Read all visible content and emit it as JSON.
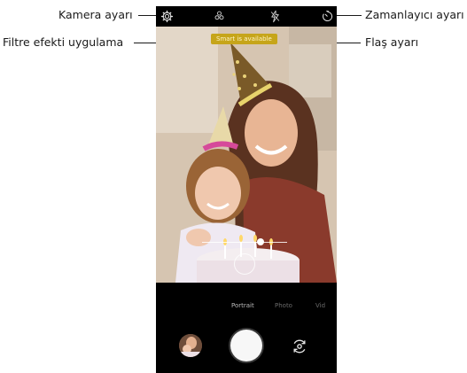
{
  "callouts": {
    "camera_settings": "Kamera ayarı",
    "apply_filter": "Filtre efekti uygulama",
    "flash": "Flaş ayarı",
    "timer": "Zamanlayıcı ayarı"
  },
  "viewfinder": {
    "banner": "Smart is available"
  },
  "modes": {
    "items": [
      "Portrait",
      "Photo",
      "Vid"
    ],
    "active": "Portrait"
  },
  "icons": {
    "settings": "gear-icon",
    "filter": "filter-icon",
    "flash": "flash-icon",
    "timer": "timer-icon",
    "switch_camera": "switch-camera-icon",
    "shutter": "shutter-button"
  }
}
